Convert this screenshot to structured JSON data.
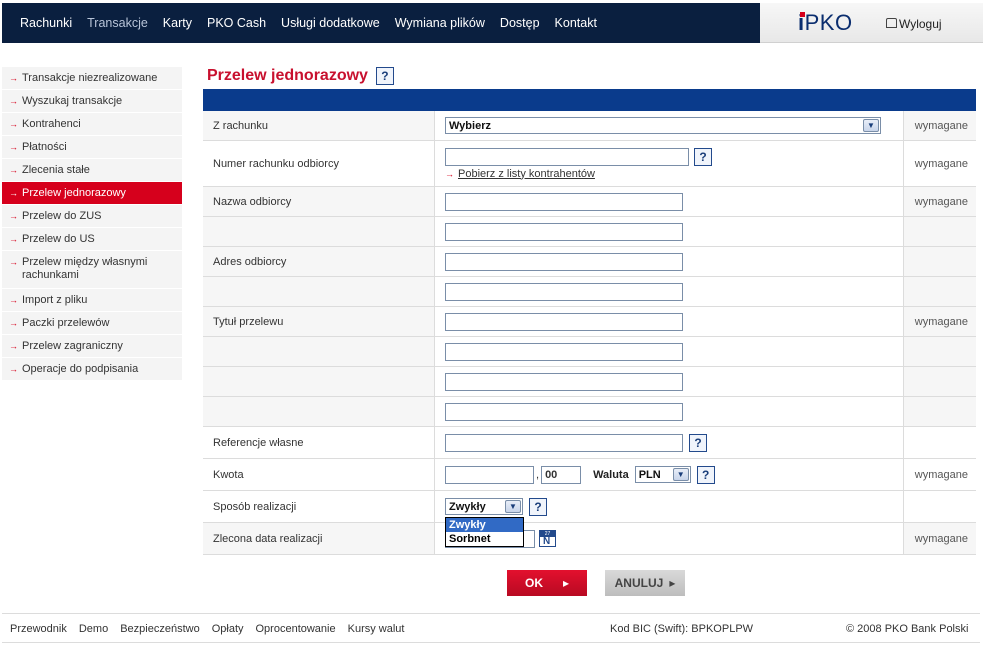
{
  "nav": {
    "items": [
      "Rachunki",
      "Transakcje",
      "Karty",
      "PKO Cash",
      "Usługi dodatkowe",
      "Wymiana plików",
      "Dostęp",
      "Kontakt"
    ],
    "active": "Transakcje"
  },
  "brand": {
    "logo_prefix": "i",
    "logo_text": "PKO",
    "logout": "Wyloguj"
  },
  "sidebar": {
    "items": [
      "Transakcje niezrealizowane",
      "Wyszukaj transakcje",
      "Kontrahenci",
      "Płatności",
      "Zlecenia stałe",
      "Przelew jednorazowy",
      "Przelew do ZUS",
      "Przelew do US",
      "Przelew między własnymi rachunkami",
      "Import z pliku",
      "Paczki przelewów",
      "Przelew zagraniczny",
      "Operacje do podpisania"
    ],
    "active_index": 5
  },
  "page": {
    "title": "Przelew jednorazowy",
    "help": "?"
  },
  "form": {
    "required_label": "wymagane",
    "from_account": {
      "label": "Z rachunku",
      "value": "Wybierz"
    },
    "recipient_account": {
      "label": "Numer rachunku odbiorcy",
      "link": "Pobierz z listy kontrahentów"
    },
    "recipient_name": {
      "label": "Nazwa odbiorcy"
    },
    "recipient_address": {
      "label": "Adres odbiorcy"
    },
    "title": {
      "label": "Tytuł przelewu"
    },
    "own_reference": {
      "label": "Referencje własne"
    },
    "amount": {
      "label": "Kwota",
      "decimals": "00",
      "comma": ",",
      "currency_label": "Waluta",
      "currency": "PLN"
    },
    "method": {
      "label": "Sposób realizacji",
      "value": "Zwykły",
      "options": [
        "Zwykły",
        "Sorbnet"
      ]
    },
    "date": {
      "label": "Zlecona data realizacji",
      "cal_top": "27",
      "cal_letter": "N"
    }
  },
  "buttons": {
    "ok": "OK",
    "cancel": "ANULUJ"
  },
  "footer": {
    "links": [
      "Przewodnik",
      "Demo",
      "Bezpieczeństwo",
      "Opłaty",
      "Oprocentowanie",
      "Kursy walut"
    ],
    "bic": "Kod BIC (Swift): BPKOPLPW",
    "copyright": "© 2008 PKO Bank Polski"
  },
  "colors": {
    "nav_bg": "#0a1f3f",
    "accent_red": "#d6001c",
    "form_bar": "#0a3b8c"
  }
}
